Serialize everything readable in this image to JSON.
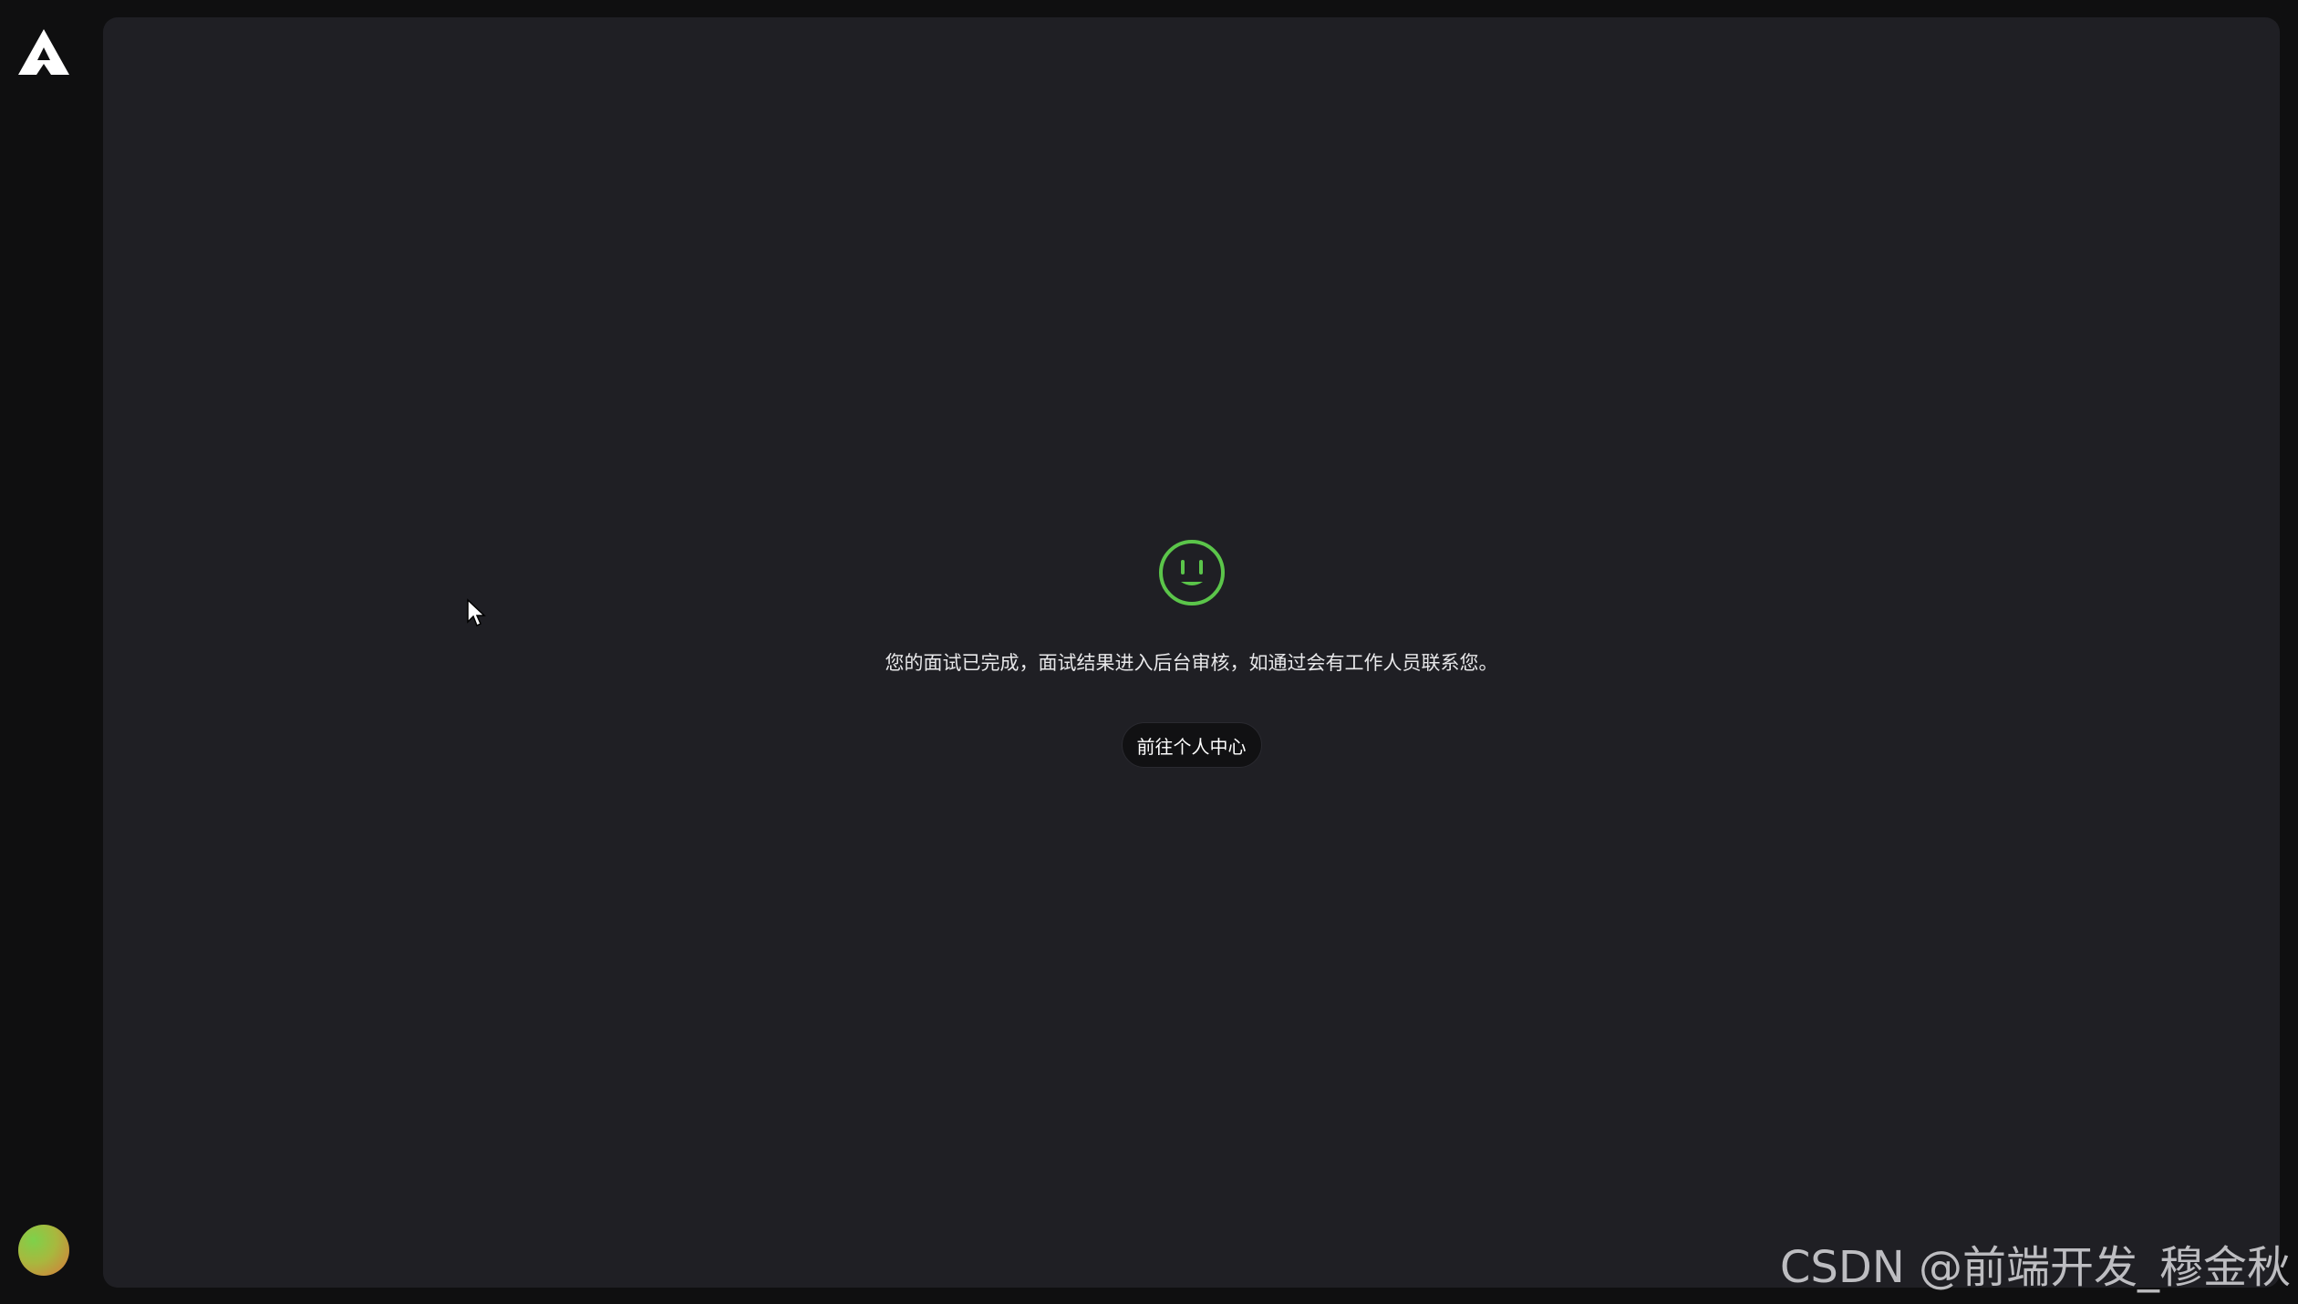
{
  "result": {
    "icon": "smile-icon",
    "icon_color": "#5bc54a",
    "message": "您的面试已完成，面试结果进入后台审核，如通过会有工作人员联系您。",
    "button_label": "前往个人中心"
  },
  "sidebar": {
    "logo_icon": "brand-logo-icon",
    "avatar_icon": "user-avatar"
  },
  "watermark": "CSDN @前端开发_穆金秋",
  "colors": {
    "background": "#0f0f10",
    "panel": "#1f1f24",
    "button": "#111113",
    "text": "#e8e8ea"
  }
}
